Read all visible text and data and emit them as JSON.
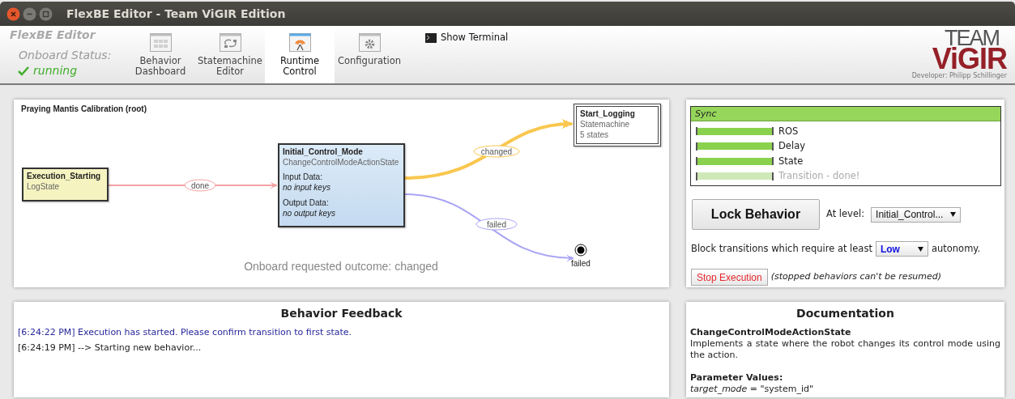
{
  "window": {
    "title": "FlexBE Editor - Team ViGIR Edition"
  },
  "header": {
    "app_name": "FlexBE Editor",
    "status_label": "Onboard Status:",
    "status": "running",
    "tabs": [
      {
        "label": "Behavior Dashboard",
        "selected": false
      },
      {
        "label": "Statemachine Editor",
        "selected": false
      },
      {
        "label": "Runtime Control",
        "selected": true
      },
      {
        "label": "Configuration",
        "selected": false
      }
    ],
    "show_terminal": "Show Terminal",
    "logo": {
      "line1": "TEAM",
      "line2": "ViGIR"
    },
    "developer": "Developer: Philipp Schillinger"
  },
  "diagram": {
    "title": "Praying Mantis Calibration (root)",
    "nodes": [
      {
        "kind": "state",
        "name": "Execution_Starting",
        "class": "LogState",
        "active": false
      },
      {
        "kind": "state",
        "name": "Initial_Control_Mode",
        "class": "ChangeControlModeActionState",
        "active": true,
        "input_label": "Input Data:",
        "input_value": "no input keys",
        "output_label": "Output Data:",
        "output_value": "no output keys"
      },
      {
        "kind": "statemachine",
        "name": "Start_Logging",
        "class": "Statemachine",
        "detail": "5 states"
      },
      {
        "kind": "outcome",
        "name": "failed"
      }
    ],
    "transitions": [
      {
        "label": "done",
        "color": "#f4a3a3",
        "highlighted": false
      },
      {
        "label": "changed",
        "color": "#f9c74f",
        "highlighted": true
      },
      {
        "label": "failed",
        "color": "#a9a4f5",
        "highlighted": false
      }
    ],
    "outcome_message": "Onboard requested outcome: changed"
  },
  "sync": {
    "title": "Sync",
    "channels": [
      {
        "name": "ROS",
        "level": 1,
        "dimmed": false
      },
      {
        "name": "Delay",
        "level": 1,
        "dimmed": false
      },
      {
        "name": "State",
        "level": 1,
        "dimmed": false
      },
      {
        "name": "Transition - done!",
        "level": 1,
        "dimmed": true
      }
    ]
  },
  "controls": {
    "lock_button": "Lock Behavior",
    "level_label": "At level:",
    "level_value": "Initial_Control...",
    "block_text": "Block transitions which require at least",
    "autonomy_value": "Low",
    "autonomy_suffix": "autonomy.",
    "stop_button": "Stop Execution",
    "stop_note": "(stopped behaviors can't be resumed)"
  },
  "feedback": {
    "title": "Behavior Feedback",
    "messages": [
      {
        "kind": "info",
        "text": "[6:24:22 PM] Execution has started. Please confirm transition to first state."
      },
      {
        "kind": "plain",
        "text": "[6:24:19 PM] --> Starting new behavior..."
      }
    ]
  },
  "documentation": {
    "title": "Documentation",
    "state_class": "ChangeControlModeActionState",
    "description": "Implements a state where the robot changes its control mode using the action.",
    "parameters_title": "Parameter Values:",
    "parameters": [
      "*target_mode* = \"system_id\""
    ]
  }
}
